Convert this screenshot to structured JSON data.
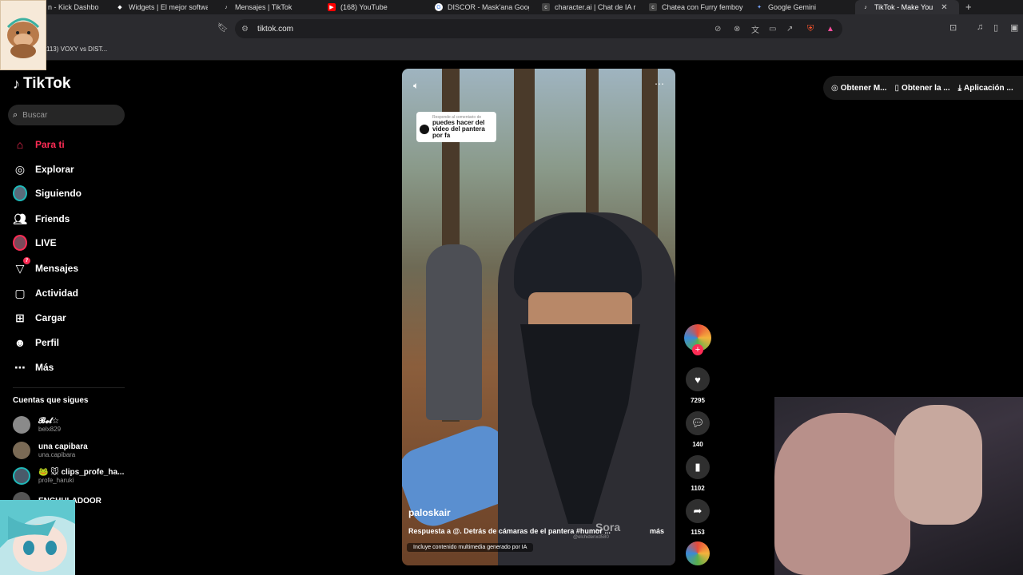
{
  "browser": {
    "tabs": [
      {
        "label": "n - Kick Dashbo",
        "icon": "kick-icon"
      },
      {
        "label": "Widgets | El mejor softwa",
        "icon": "widget-icon"
      },
      {
        "label": "Mensajes | TikTok",
        "icon": "tiktok-icon"
      },
      {
        "label": "(168) YouTube",
        "icon": "youtube-icon"
      },
      {
        "label": "DISCOR - Mask'ana Goog",
        "icon": "google-icon"
      },
      {
        "label": "character.ai | Chat de IA r",
        "icon": "characterai-icon"
      },
      {
        "label": "Chatea con Furry femboy",
        "icon": "characterai-icon"
      },
      {
        "label": "Google Gemini",
        "icon": "gemini-icon"
      },
      {
        "label": "TikTok - Make You",
        "icon": "tiktok-icon",
        "active": true
      }
    ],
    "url": "tiktok.com",
    "bookmark": "113) VOXY vs DIST..."
  },
  "sidebar": {
    "logo": "TikTok",
    "search_placeholder": "Buscar",
    "nav": [
      {
        "label": "Para ti",
        "icon": "home-icon",
        "active": true
      },
      {
        "label": "Explorar",
        "icon": "compass-icon"
      },
      {
        "label": "Siguiendo",
        "icon": "following-avatar-icon"
      },
      {
        "label": "Friends",
        "icon": "friends-icon"
      },
      {
        "label": "LIVE",
        "icon": "live-icon"
      },
      {
        "label": "Mensajes",
        "icon": "messages-icon",
        "badge": "7"
      },
      {
        "label": "Actividad",
        "icon": "activity-icon"
      },
      {
        "label": "Cargar",
        "icon": "upload-icon"
      },
      {
        "label": "Perfil",
        "icon": "profile-icon"
      },
      {
        "label": "Más",
        "icon": "more-icon"
      }
    ],
    "following_heading": "Cuentas que sigues",
    "following": [
      {
        "name": "𝓑𝓮𝓵☆",
        "handle": "belx829"
      },
      {
        "name": "una capibara",
        "handle": "una.capibara"
      },
      {
        "name": "🐸 🐭 clips_profe_ha...",
        "handle": "profe_haruki"
      },
      {
        "name": "ENCHULADOOR",
        "handle": ""
      }
    ]
  },
  "video": {
    "reply_heading": "Responde al comentario de",
    "reply_text": "puedes hacer del video del pantera por fa",
    "author": "paloskair",
    "caption": "Respuesta a @. Detrás de cámaras de el pantera #humor ...",
    "more": "más",
    "ai_label": "Incluye contenido multimedia generado por IA",
    "watermark": "Sora",
    "watermark_handle": "@elchidenxd580"
  },
  "actions": {
    "likes": "7295",
    "comments": "140",
    "saves": "1102",
    "shares": "1153"
  },
  "top_actions": [
    {
      "label": "Obtener M...",
      "icon": "coin-icon"
    },
    {
      "label": "Obtener la ...",
      "icon": "phone-icon"
    },
    {
      "label": "Aplicación ...",
      "icon": "download-icon"
    }
  ],
  "colors": {
    "accent": "#fe2c55",
    "background": "#000000"
  }
}
